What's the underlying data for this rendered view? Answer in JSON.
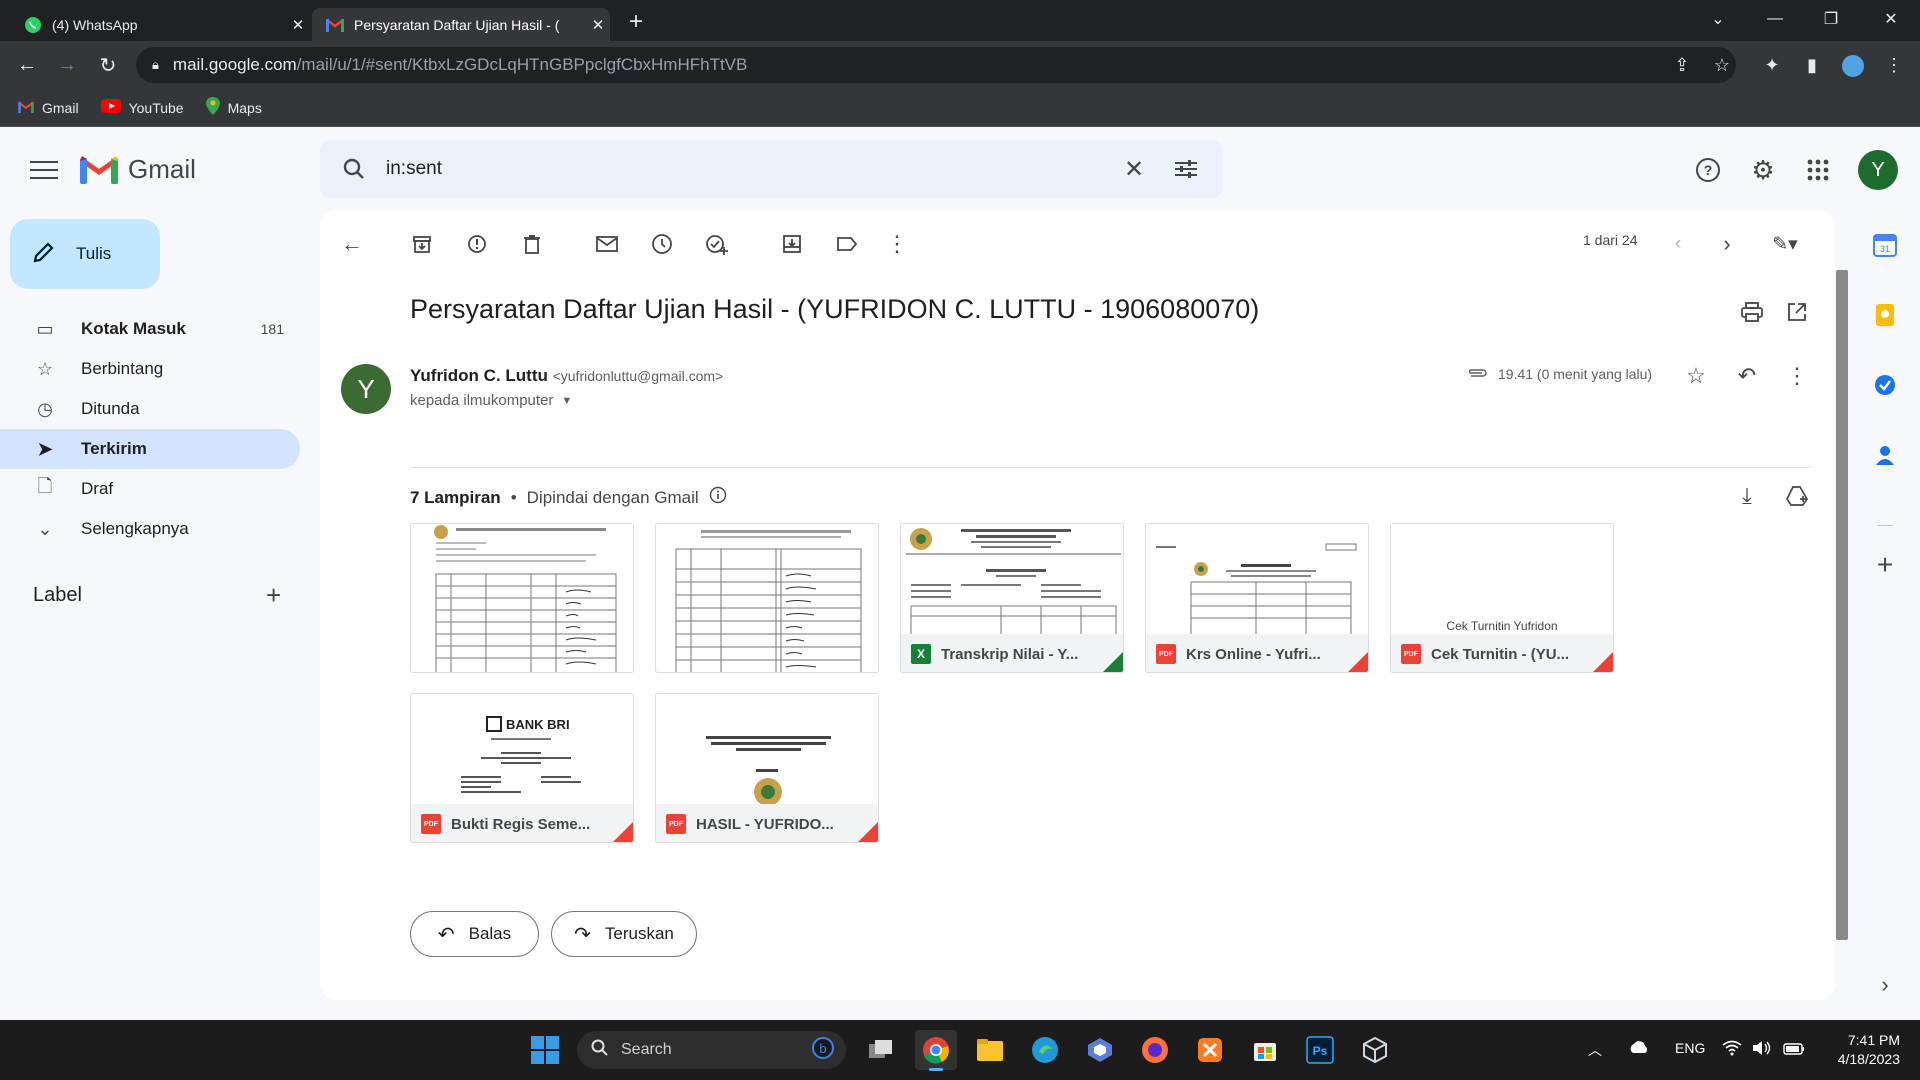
{
  "browser": {
    "tabs": [
      {
        "title": "(4) WhatsApp",
        "icon": "whatsapp-icon"
      },
      {
        "title": "Persyaratan Daftar Ujian Hasil - (",
        "icon": "gmail-icon"
      }
    ],
    "url_host": "mail.google.com",
    "url_path": "/mail/u/1/#sent/KtbxLzGDcLqHTnGBPpclgfCbxHmHFhTtVB",
    "bookmarks": [
      {
        "label": "Gmail",
        "icon": "gmail-icon"
      },
      {
        "label": "YouTube",
        "icon": "youtube-icon"
      },
      {
        "label": "Maps",
        "icon": "maps-icon"
      }
    ]
  },
  "gmail": {
    "logo_text": "Gmail",
    "search_query": "in:sent",
    "account_initial": "Y",
    "compose_label": "Tulis",
    "nav": [
      {
        "label": "Kotak Masuk",
        "count": "181",
        "icon": "inbox-icon",
        "bold": true
      },
      {
        "label": "Berbintang",
        "icon": "star-icon"
      },
      {
        "label": "Ditunda",
        "icon": "clock-icon"
      },
      {
        "label": "Terkirim",
        "icon": "send-icon",
        "selected": true
      },
      {
        "label": "Draf",
        "icon": "draft-icon"
      },
      {
        "label": "Selengkapnya",
        "icon": "chevron-down-icon"
      }
    ],
    "labels_heading": "Label",
    "pagination": "1 dari 24"
  },
  "email": {
    "subject": "Persyaratan Daftar Ujian Hasil - (YUFRIDON C. LUTTU - 1906080070)",
    "sender_name": "Yufridon C. Luttu",
    "sender_email": "<yufridonluttu@gmail.com>",
    "recipient": "kepada ilmukomputer",
    "time": "19.41 (0 menit yang lalu)",
    "sender_initial": "Y",
    "attachments_count": "7 Lampiran",
    "scanned_note": "Dipindai dengan Gmail",
    "attachments": [
      {
        "name": "",
        "type": "image"
      },
      {
        "name": "",
        "type": "image"
      },
      {
        "name": "Transkrip Nilai - Y...",
        "type": "xls"
      },
      {
        "name": "Krs Online - Yufri...",
        "type": "pdf"
      },
      {
        "name": "Cek Turnitin - (YU...",
        "type": "pdf",
        "thumb_text": "Cek Turnitin Yufridon"
      },
      {
        "name": "Bukti Regis Seme...",
        "type": "pdf",
        "thumb_text": "BANK BRI"
      },
      {
        "name": "HASIL - YUFRIDO...",
        "type": "pdf"
      }
    ],
    "reply_label": "Balas",
    "forward_label": "Teruskan"
  },
  "taskbar": {
    "search_label": "Search",
    "lang": "ENG",
    "time": "7:41 PM",
    "date": "4/18/2023"
  }
}
